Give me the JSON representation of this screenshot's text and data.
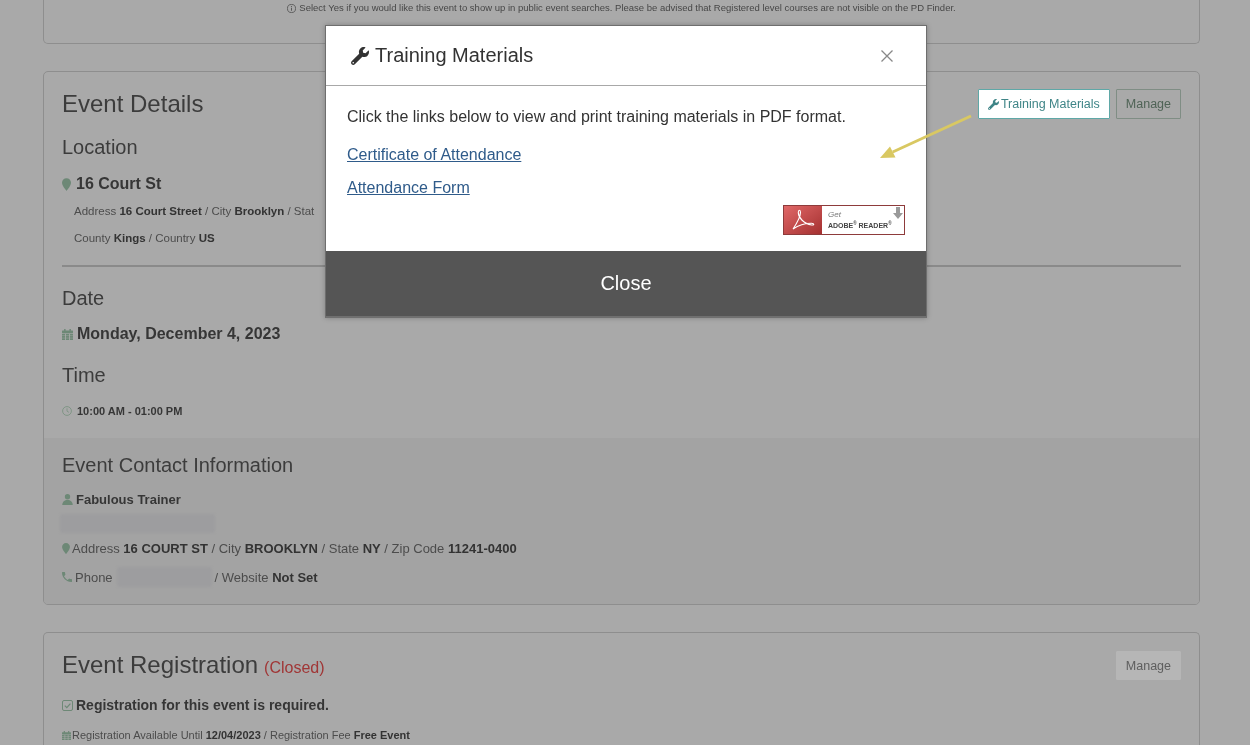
{
  "notice": {
    "text": "Select Yes if you would like this event to show up in public event searches. Please be advised that Registered level courses are not visible on the PD Finder."
  },
  "event_details": {
    "title": "Event Details",
    "buttons": [
      {
        "label": "Training Materials",
        "kind": "materials",
        "highlighted": true,
        "disabled": false
      },
      {
        "label": "Manage",
        "kind": "manage",
        "highlighted": false,
        "disabled": false
      }
    ],
    "location": {
      "heading": "Location",
      "name": "16 Court St",
      "lines": [
        "Address **16 Court Street** / City **Brooklyn** / Stat",
        "County **Kings** / Country **US**"
      ]
    },
    "date": {
      "heading": "Date",
      "value": "Monday, December 4, 2023"
    },
    "time": {
      "heading": "Time",
      "value": "10:00 AM - 01:00 PM"
    },
    "contact": {
      "heading": "Event Contact Information",
      "name": "Fabulous Trainer",
      "email_redacted": true,
      "address": "Address **16 COURT ST** / City **BROOKLYN** / State **NY** / Zip Code **11241-0400**",
      "phone_label": "Phone",
      "phone_redacted": true,
      "website": "/ Website **Not Set**"
    }
  },
  "event_registration": {
    "title": "Event Registration",
    "status": "(Closed)",
    "buttons": [
      {
        "label": "Manage",
        "highlighted": false,
        "disabled": true
      }
    ],
    "requirement": {
      "text": "Registration for this event is required.",
      "checked": true
    },
    "details": "Registration Available Until **12/04/2023** / Registration Fee **Free Event**"
  },
  "modal": {
    "title": "Training Materials",
    "intro": "Click the links below to view and print training materials in PDF format.",
    "links": [
      "Certificate of Attendance",
      "Attendance Form"
    ],
    "reader_badge": {
      "line_1": "Get",
      "line_2": "ADOBE$^{®}$ READER$^{®}$"
    },
    "close_button": "Close"
  }
}
